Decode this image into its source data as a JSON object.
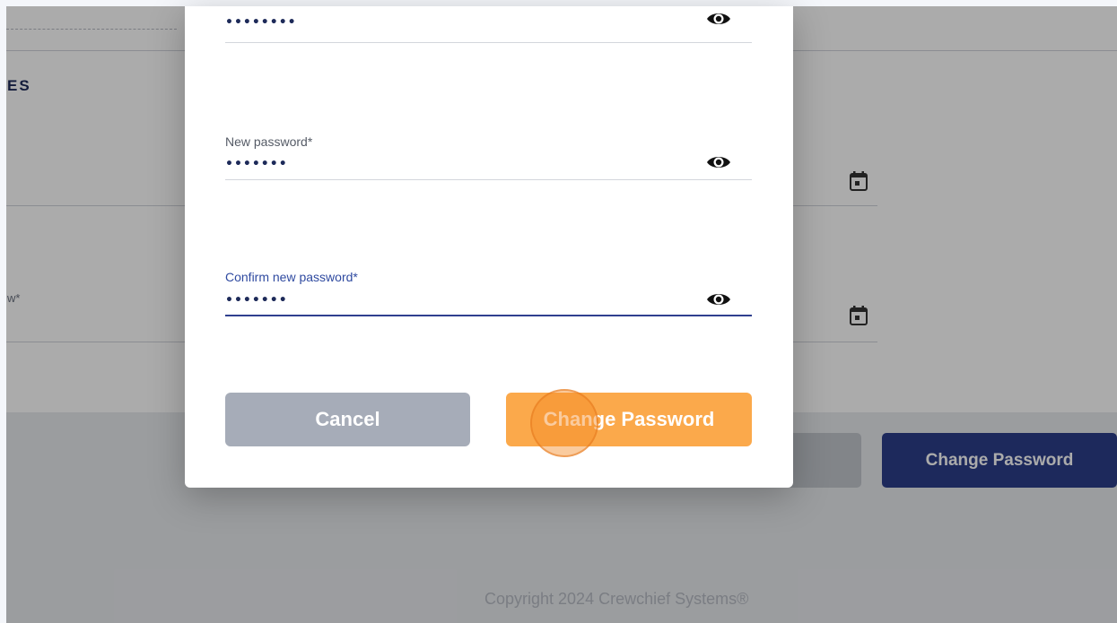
{
  "background": {
    "section_title": "ES",
    "field_label_partial": "w*",
    "change_password_button": "Change Password",
    "copyright": "Copyright 2024 Crewchief Systems®"
  },
  "modal": {
    "fields": [
      {
        "label": "",
        "value": "••••••••",
        "icon": "eye-icon"
      },
      {
        "label": "New password*",
        "value": "•••••••",
        "icon": "eye-icon"
      },
      {
        "label": "Confirm new password*",
        "value": "•••••••",
        "icon": "eye-icon"
      }
    ],
    "cancel_label": "Cancel",
    "change_label": "Change Password"
  },
  "colors": {
    "primary": "#2c3e8a",
    "accent_orange": "#fba94b",
    "cancel_gray": "#a6acb8"
  }
}
